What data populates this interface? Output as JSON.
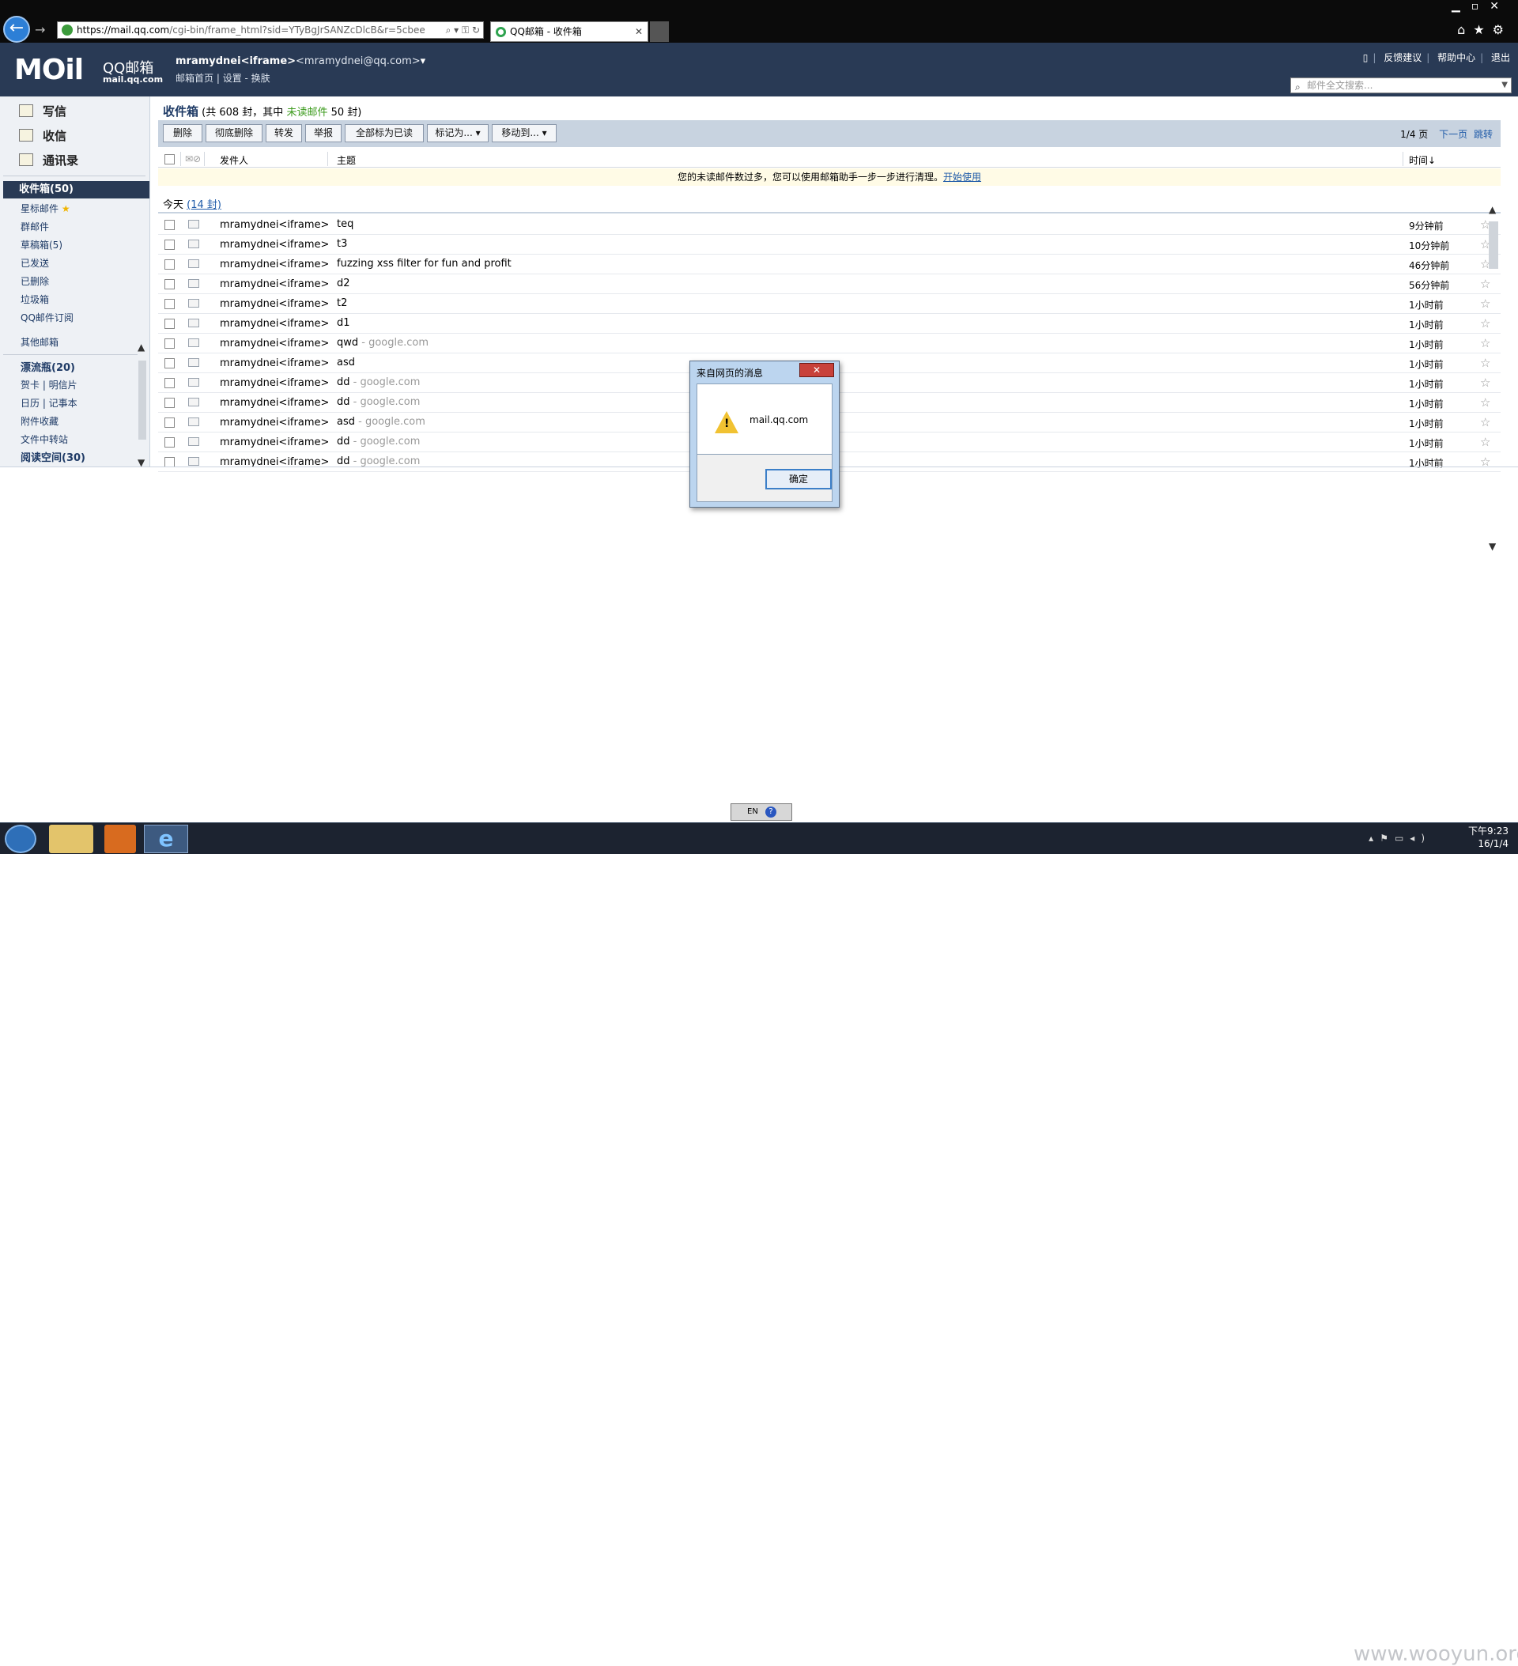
{
  "browser": {
    "address_host": "https://mail.qq.com",
    "address_rest": "/cgi-bin/frame_html?sid=YTyBgJrSANZcDlcB&r=5cbee",
    "tab_title": "QQ邮箱 - 收件箱"
  },
  "header": {
    "logo_mark": "MOil",
    "logo_text": "QQ邮箱",
    "logo_sub": "mail.qq.com",
    "user_name": "mramydnei<iframe>",
    "user_email": "<mramydnei@qq.com>",
    "user_email_caret": "▾",
    "links": [
      "邮箱首页",
      "设置",
      "换肤"
    ],
    "right_links": [
      "反馈建议",
      "帮助中心",
      "退出"
    ],
    "search_placeholder": "邮件全文搜索..."
  },
  "sidebar": {
    "main": [
      "写信",
      "收信",
      "通讯录"
    ],
    "inbox_label": "收件箱(50)",
    "folders": [
      "星标邮件",
      "群邮件",
      "草稿箱(5)",
      "已发送",
      "已删除",
      "垃圾箱",
      "QQ邮件订阅"
    ],
    "other": "其他邮箱",
    "extras": [
      "漂流瓶(20)",
      "贺卡 | 明信片",
      "日历 | 记事本",
      "附件收藏",
      "文件中转站",
      "阅读空间(30)"
    ]
  },
  "main": {
    "title": "收件箱",
    "title_count_a": " (共 608 封，其中 ",
    "title_unread": "未读邮件",
    "title_count_b": " 50 封)",
    "toolbar": [
      "删除",
      "彻底删除",
      "转发",
      "举报",
      "全部标为已读",
      "标记为... ▾",
      "移动到... ▾"
    ],
    "pager_page": "1/4 页",
    "pager_next": "下一页",
    "pager_jump": "跳转",
    "col_from": "发件人",
    "col_subject": "主题",
    "col_time": "时间↓",
    "notice": "您的未读邮件数过多，您可以使用邮箱助手一步一步进行清理。",
    "notice_link": "开始使用",
    "group_label": "今天",
    "group_count": "(14 封)",
    "rows": [
      {
        "from": "mramydnei<iframe>",
        "subject": "teq",
        "dim": "",
        "time": "9分钟前"
      },
      {
        "from": "mramydnei<iframe>",
        "subject": "t3",
        "dim": "",
        "time": "10分钟前"
      },
      {
        "from": "mramydnei<iframe>",
        "subject": "fuzzing xss filter for fun and profit",
        "dim": "",
        "time": "46分钟前"
      },
      {
        "from": "mramydnei<iframe>",
        "subject": "d2",
        "dim": "",
        "time": "56分钟前"
      },
      {
        "from": "mramydnei<iframe>",
        "subject": "t2",
        "dim": "",
        "time": "1小时前"
      },
      {
        "from": "mramydnei<iframe>",
        "subject": "d1",
        "dim": "",
        "time": "1小时前"
      },
      {
        "from": "mramydnei<iframe>",
        "subject": "qwd",
        "dim": " - google.com",
        "time": "1小时前"
      },
      {
        "from": "mramydnei<iframe>",
        "subject": "asd",
        "dim": "",
        "time": "1小时前"
      },
      {
        "from": "mramydnei<iframe>",
        "subject": "dd",
        "dim": " - google.com",
        "time": "1小时前"
      },
      {
        "from": "mramydnei<iframe>",
        "subject": "dd",
        "dim": " - google.com",
        "time": "1小时前"
      },
      {
        "from": "mramydnei<iframe>",
        "subject": "asd",
        "dim": " - google.com",
        "time": "1小时前"
      },
      {
        "from": "mramydnei<iframe>",
        "subject": "dd",
        "dim": " - google.com",
        "time": "1小时前"
      },
      {
        "from": "mramydnei<iframe>",
        "subject": "dd",
        "dim": " - google.com",
        "time": "1小时前"
      }
    ]
  },
  "dialog": {
    "title": "来自网页的消息",
    "close": "✕",
    "message": "mail.qq.com",
    "ok": "确定"
  },
  "ime": {
    "lang": "EN",
    "help": "?"
  },
  "taskbar": {
    "time": "下午9:23",
    "date": "16/1/4",
    "watermark": "www.wooyun.org"
  },
  "colors": {
    "header_bg": "#293a55",
    "toolbar_bg": "#c8d3e0",
    "link": "#1e5aa8",
    "unread_green": "#3a9a1a"
  }
}
